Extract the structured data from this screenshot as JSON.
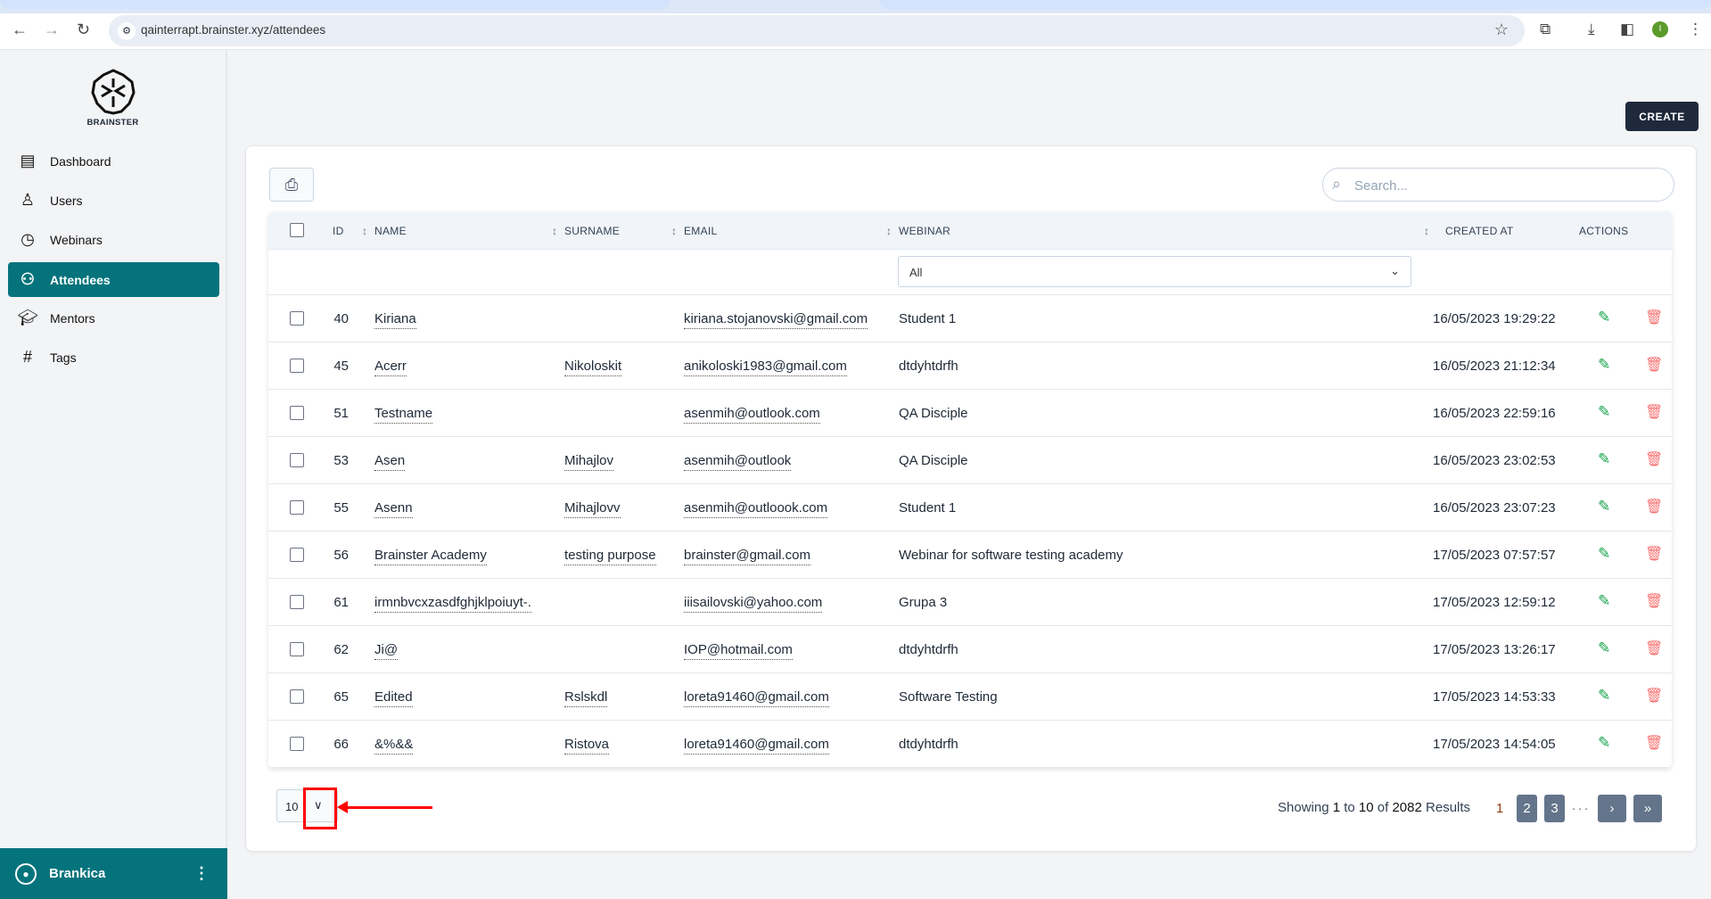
{
  "browser": {
    "url": "qainterrapt.brainster.xyz/attendees",
    "profile_initial": "I"
  },
  "sidebar": {
    "logo_text": "BRAINSTER",
    "items": [
      {
        "label": "Dashboard",
        "icon": "dashboard-icon"
      },
      {
        "label": "Users",
        "icon": "user-icon"
      },
      {
        "label": "Webinars",
        "icon": "clock-icon"
      },
      {
        "label": "Attendees",
        "icon": "attendees-icon",
        "active": true
      },
      {
        "label": "Mentors",
        "icon": "mentor-cap-icon"
      },
      {
        "label": "Tags",
        "icon": "hash-icon"
      }
    ],
    "user": "Brankica"
  },
  "toolbar": {
    "create_label": "CREATE"
  },
  "search": {
    "placeholder": "Search..."
  },
  "table": {
    "headers": {
      "id": "ID",
      "name": "NAME",
      "surname": "SURNAME",
      "email": "EMAIL",
      "webinar": "WEBINAR",
      "created": "CREATED AT",
      "actions": "ACTIONS"
    },
    "webinar_filter": "All",
    "rows": [
      {
        "id": "40",
        "name": "Kiriana",
        "surname": "",
        "email": "kiriana.stojanovski@gmail.com",
        "webinar": "Student 1",
        "created": "16/05/2023 19:29:22"
      },
      {
        "id": "45",
        "name": "Acerr",
        "surname": "Nikoloskit",
        "email": "anikoloski1983@gmail.com",
        "webinar": "dtdyhtdrfh",
        "created": "16/05/2023 21:12:34"
      },
      {
        "id": "51",
        "name": "Testname",
        "surname": "",
        "email": "asenmih@outlook.com",
        "webinar": "QA Disciple",
        "created": "16/05/2023 22:59:16"
      },
      {
        "id": "53",
        "name": "Asen",
        "surname": "Mihajlov",
        "email": "asenmih@outlook",
        "webinar": "QA Disciple",
        "created": "16/05/2023 23:02:53"
      },
      {
        "id": "55",
        "name": "Asenn",
        "surname": "Mihajlovv",
        "email": "asenmih@outloook.com",
        "webinar": "Student 1",
        "created": "16/05/2023 23:07:23"
      },
      {
        "id": "56",
        "name": "Brainster Academy",
        "surname": "testing purpose",
        "email": "brainster@gmail.com",
        "webinar": "Webinar for software testing academy",
        "created": "17/05/2023 07:57:57"
      },
      {
        "id": "61",
        "name": "irmnbvcxzasdfghjklpoiuyt-.",
        "surname": "",
        "email": "iiisailovski@yahoo.com",
        "webinar": "Grupa 3",
        "created": "17/05/2023 12:59:12"
      },
      {
        "id": "62",
        "name": "Ji@",
        "surname": "",
        "email": "IOP@hotmail.com",
        "webinar": "dtdyhtdrfh",
        "created": "17/05/2023 13:26:17"
      },
      {
        "id": "65",
        "name": "Edited",
        "surname": "Rslskdl",
        "email": "loreta91460@gmail.com",
        "webinar": "Software Testing",
        "created": "17/05/2023 14:53:33"
      },
      {
        "id": "66",
        "name": "&%&&",
        "surname": "Ristova",
        "email": "loreta91460@gmail.com",
        "webinar": "dtdyhtdrfh",
        "created": "17/05/2023 14:54:05"
      }
    ]
  },
  "pagination": {
    "per_page": "10",
    "showing_prefix": "Showing",
    "from": "1",
    "to_word": "to",
    "to": "10",
    "of_word": "of",
    "total": "2082",
    "results_word": "Results",
    "pages": [
      "1",
      "2",
      "3"
    ],
    "ellipsis": "···",
    "next": "›",
    "last": "»"
  },
  "colors": {
    "accent": "#05737c",
    "dark": "#1e293b",
    "edit": "#16a34a",
    "delete": "#f87171",
    "annotation": "#ff0000"
  }
}
